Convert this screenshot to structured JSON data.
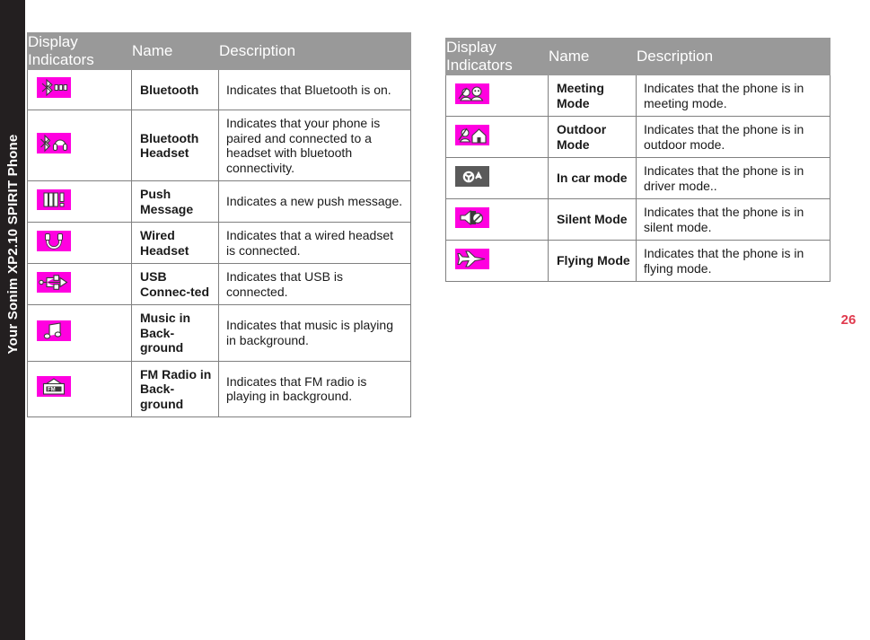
{
  "sidebar": {
    "label": "Your Sonim XP2.10 SPIRIT Phone",
    "background_color": "#231f20",
    "text_color": "#ffffff"
  },
  "page": {
    "number": "26",
    "number_color": "#e03a4e",
    "background_color": "#ffffff"
  },
  "theme": {
    "header_background": "#999999",
    "header_text": "#ffffff",
    "border_color": "#808080",
    "icon_chip_color": "#ff00e0",
    "icon_chip_dark_color": "#5a5a5a",
    "body_text": "#1a1a1a"
  },
  "tables": [
    {
      "id": "left-indicators-table",
      "columns": [
        "Display Indicators",
        "Name",
        "Description"
      ],
      "rows": [
        {
          "icon": "bluetooth-icon",
          "icon_style": "magenta",
          "name": "Bluetooth",
          "description": "Indicates that Bluetooth is on."
        },
        {
          "icon": "bluetooth-headset-icon",
          "icon_style": "magenta",
          "name": "Bluetooth Headset",
          "description": "Indicates that your phone is paired and connected to a headset with bluetooth connectivity."
        },
        {
          "icon": "push-message-icon",
          "icon_style": "magenta",
          "name": "Push Message",
          "description": "Indicates a new push message."
        },
        {
          "icon": "wired-headset-icon",
          "icon_style": "magenta",
          "name": "Wired Headset",
          "description": "Indicates that a wired headset is connected."
        },
        {
          "icon": "usb-connected-icon",
          "icon_style": "magenta",
          "name": "USB Connec-ted",
          "description": "Indicates that USB is connected."
        },
        {
          "icon": "music-note-icon",
          "icon_style": "magenta",
          "name": "Music in Back-ground",
          "description": "Indicates that music is playing in background."
        },
        {
          "icon": "fm-radio-icon",
          "icon_style": "magenta",
          "name": "FM Radio in Back-ground",
          "description": "Indicates that FM radio is playing in background."
        }
      ]
    },
    {
      "id": "right-indicators-table",
      "columns": [
        "Display Indicators",
        "Name",
        "Description"
      ],
      "rows": [
        {
          "icon": "meeting-mode-icon",
          "icon_style": "magenta",
          "name": "Meeting Mode",
          "description": "Indicates that the phone is in meeting mode."
        },
        {
          "icon": "outdoor-mode-icon",
          "icon_style": "magenta",
          "name": "Outdoor Mode",
          "description": "Indicates that the phone is in outdoor mode."
        },
        {
          "icon": "in-car-mode-icon",
          "icon_style": "dark",
          "name": "In car mode",
          "description": "Indicates that the phone is in driver mode.."
        },
        {
          "icon": "silent-mode-icon",
          "icon_style": "magenta",
          "name": "Silent Mode",
          "description": "Indicates that the phone is in silent mode."
        },
        {
          "icon": "flying-mode-icon",
          "icon_style": "magenta",
          "name": "Flying Mode",
          "description": "Indicates that the phone is in flying mode."
        }
      ]
    }
  ]
}
